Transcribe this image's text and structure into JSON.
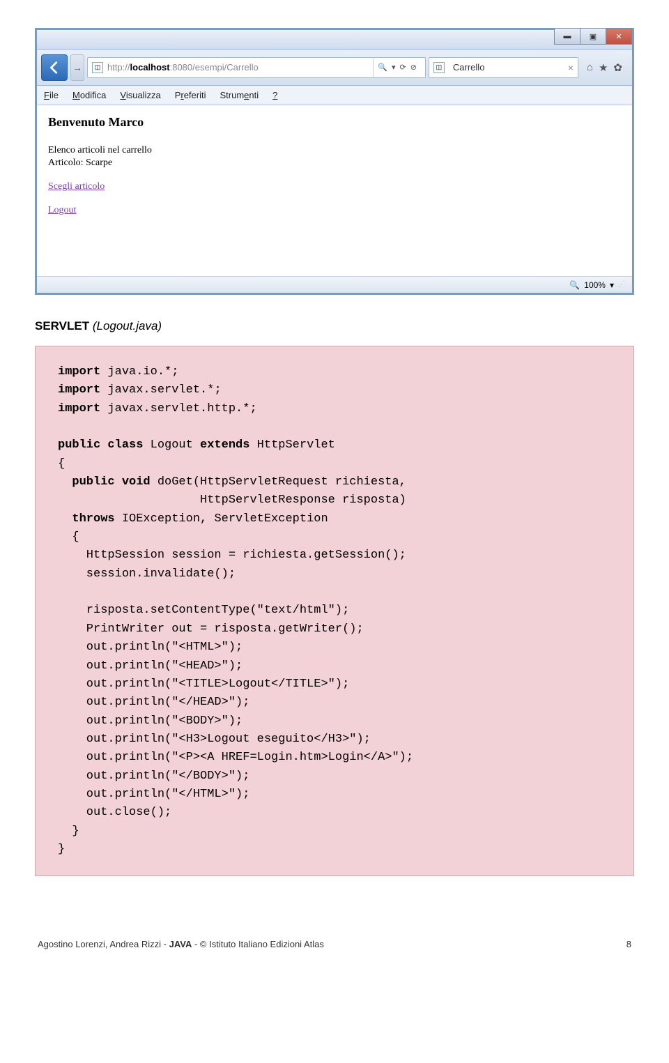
{
  "browser": {
    "win_controls": {
      "min": "▬",
      "max": "▣",
      "close": "✕"
    },
    "back": "←",
    "forward": "→",
    "url_prefix": "http://",
    "url_host": "localhost",
    "url_path": ":8080/esempi/Carrello",
    "search_glyph": "🔍",
    "dropdown": "▾",
    "refresh": "⟳",
    "stop": "⊘",
    "tab_title": "Carrello",
    "tab_close": "×",
    "icon_home": "⌂",
    "icon_fav": "★",
    "icon_gear": "✿",
    "menus": [
      "File",
      "Modifica",
      "Visualizza",
      "Preferiti",
      "Strumenti",
      "?"
    ],
    "menu_keys": [
      "F",
      "M",
      "V",
      "P",
      "S",
      "?"
    ]
  },
  "page_content": {
    "heading": "Benvenuto Marco",
    "line1": "Elenco articoli nel carrello",
    "line2": "Articolo: Scarpe",
    "link1": "Scegli articolo",
    "link2": "Logout"
  },
  "status": {
    "zoom": "100%",
    "zoom_dropdown": "▾"
  },
  "section": {
    "label": "SERVLET",
    "file": "(Logout.java)"
  },
  "code": {
    "l1": "import java.io.*;",
    "l2": "import javax.servlet.*;",
    "l3": "import javax.servlet.http.*;",
    "l4": "public class Logout extends HttpServlet",
    "l5": "{",
    "l6": "  public void doGet(HttpServletRequest richiesta,",
    "l7": "                    HttpServletResponse risposta)",
    "l8": "  throws IOException, ServletException",
    "l9": "  {",
    "l10": "    HttpSession session = richiesta.getSession();",
    "l11": "    session.invalidate();",
    "l12": "    risposta.setContentType(\"text/html\");",
    "l13": "    PrintWriter out = risposta.getWriter();",
    "l14": "    out.println(\"<HTML>\");",
    "l15": "    out.println(\"<HEAD>\");",
    "l16": "    out.println(\"<TITLE>Logout</TITLE>\");",
    "l17": "    out.println(\"</HEAD>\");",
    "l18": "    out.println(\"<BODY>\");",
    "l19": "    out.println(\"<H3>Logout eseguito</H3>\");",
    "l20": "    out.println(\"<P><A HREF=Login.htm>Login</A>\");",
    "l21": "    out.println(\"</BODY>\");",
    "l22": "    out.println(\"</HTML>\");",
    "l23": "    out.close();",
    "l24": "  }",
    "l25": "}"
  },
  "footer": {
    "authors": "Agostino Lorenzi, Andrea Rizzi - ",
    "book": "JAVA",
    "publisher": " - © Istituto Italiano Edizioni Atlas",
    "page": "8"
  }
}
